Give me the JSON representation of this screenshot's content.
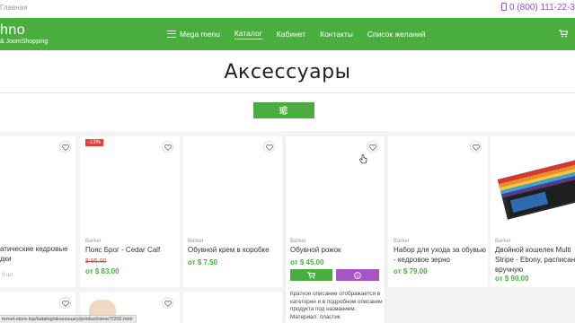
{
  "topbar": {
    "breadcrumb": "Главная",
    "phone": "0 (800) 111-22-3"
  },
  "header": {
    "logo_name": "hno",
    "logo_sub": "& JoomShopping",
    "nav": [
      {
        "label": "Mega menu"
      },
      {
        "label": "Каталог"
      },
      {
        "label": "Кабинет"
      },
      {
        "label": "Контакты"
      },
      {
        "label": "Список желаний"
      }
    ],
    "active_nav": "Каталог"
  },
  "page": {
    "title": "Аксессуары"
  },
  "colors": {
    "accent": "#4aae3f",
    "sale": "#e2413a",
    "secondary": "#a855c4"
  },
  "products": [
    {
      "name_l1": "атические кедровые",
      "name_l2": "дки",
      "qty": "0 шт"
    },
    {
      "badge": "-13%",
      "brand": "Barker",
      "name": "Пояс Брог - Cedar Calf",
      "old_price": "$ 95.00",
      "price": "от $ 83.00"
    },
    {
      "brand": "Barker",
      "name": "Обувной крем в коробке",
      "price": "от $ 7.50"
    },
    {
      "brand": "Barker",
      "name": "Обувной рожок",
      "price": "от $ 45.00",
      "desc_lines": [
        "Краткое описание отображается в",
        "категории и в подробном описании",
        "продукта под названием.",
        "Материал: пластик"
      ]
    },
    {
      "brand": "Barker",
      "name_l1": "Набор для ухода за обувью",
      "name_l2": "- кедровое зерно",
      "price": "от $ 79.00"
    },
    {
      "brand": "Barker",
      "name_l1": "Двойной кошелек Multi",
      "name_l2": "Stripe - Ebony, расписанный",
      "name_l3": "вручную",
      "price": "от $ 90.00"
    }
  ],
  "status_url": "ternet-store.top/katalog/aksessuary/product/view/7/202.html"
}
